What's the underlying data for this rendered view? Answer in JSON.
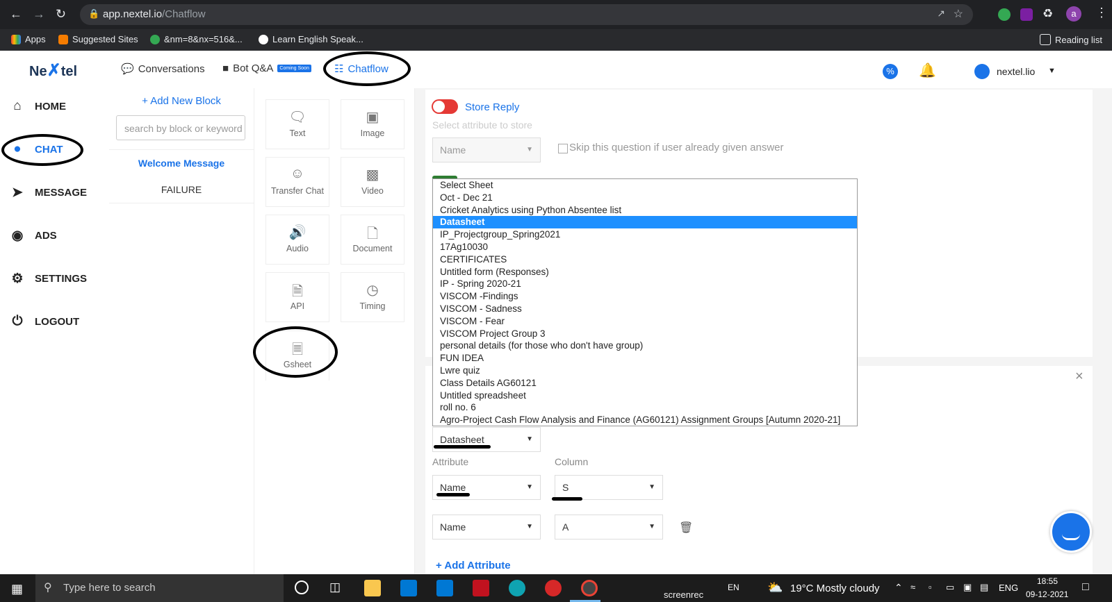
{
  "browser": {
    "url_domain": "app.nextel.io",
    "url_path": "/Chatflow",
    "bookmarks": [
      "Apps",
      "Suggested Sites",
      "&nm=8&nx=516&...",
      "Learn English Speak..."
    ],
    "reading_list": "Reading list",
    "profile_initial": "a"
  },
  "app": {
    "logo_text_1": "Ne",
    "logo_text_2": "tel",
    "tabs": [
      {
        "label": "Conversations"
      },
      {
        "label": "Bot Q&A",
        "badge": "Coming Soon"
      },
      {
        "label": "Chatflow"
      }
    ],
    "account_name": "nextel.lio"
  },
  "sidebar": {
    "items": [
      {
        "label": "HOME"
      },
      {
        "label": "CHAT"
      },
      {
        "label": "MESSAGE"
      },
      {
        "label": "ADS"
      },
      {
        "label": "SETTINGS"
      },
      {
        "label": "LOGOUT"
      }
    ]
  },
  "blocks": {
    "add_label": "+ Add New Block",
    "search_placeholder": "search by block or keyword",
    "list": [
      "Welcome Message",
      "FAILURE"
    ]
  },
  "tools": [
    "Text",
    "Image",
    "Transfer Chat",
    "Video",
    "Audio",
    "Document",
    "API",
    "Timing",
    "Gsheet"
  ],
  "editor": {
    "store_reply_label": "Store Reply",
    "select_attr_placeholder": "Select attribute to store",
    "store_select_value": "Name",
    "skip_label": "Skip this question if user already given answer",
    "sheet_options": [
      "Select Sheet",
      "Oct - Dec 21",
      "Cricket Analytics using Python Absentee list",
      "Datasheet",
      "IP_Projectgroup_Spring2021",
      "17Ag10030",
      "CERTIFICATES",
      "Untitled form (Responses)",
      "IP - Spring 2020-21",
      "VISCOM -Findings",
      "VISCOM - Sadness",
      "VISCOM - Fear",
      "VISCOM Project Group 3",
      "personal details (for those who don't have group)",
      "FUN IDEA",
      "Lwre quiz",
      "Class Details AG60121",
      "Untitled spreadsheet",
      "roll no. 6",
      "Agro-Project Cash Flow Analysis and Finance (AG60121) Assignment Groups [Autumn 2020-21]"
    ],
    "selected_sheet": "Datasheet",
    "attribute_label": "Attribute",
    "column_label": "Column",
    "rows": [
      {
        "attribute": "Name",
        "column": "S"
      },
      {
        "attribute": "Name",
        "column": "A"
      }
    ],
    "add_attribute": "+ Add Attribute"
  },
  "taskbar": {
    "search_placeholder": "Type here to search",
    "recorder": "screenrec",
    "lang_short": "EN",
    "weather": "19°C  Mostly cloudy",
    "lang": "ENG",
    "time": "18:55",
    "date": "09-12-2021"
  },
  "colors": {
    "accent": "#1a73e8",
    "toggle_off": "#e53935",
    "selection": "#1e90ff"
  }
}
